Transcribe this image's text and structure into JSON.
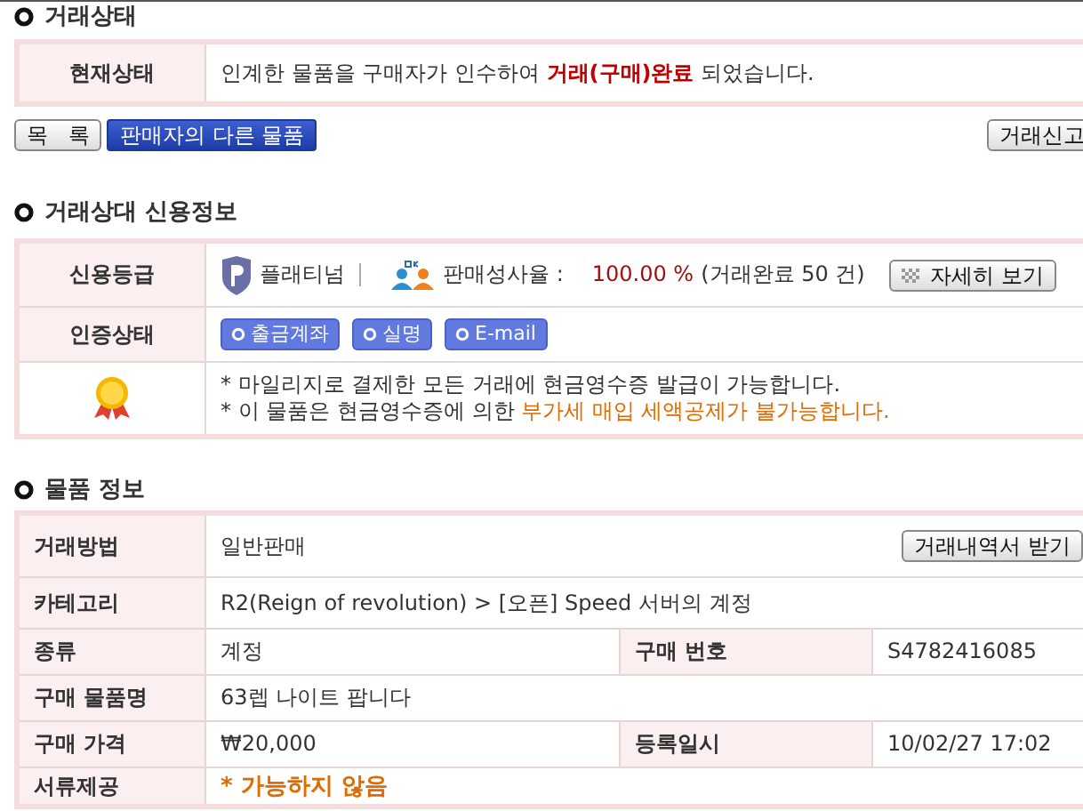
{
  "trade_status": {
    "heading": "거래상태",
    "label": "현재상태",
    "message": "인계한 물품을 구매자가 인수하여 **거래(구매)완료** 되었습니다."
  },
  "buttons": [
    {
      "label": "목   록",
      "kind": "plain"
    },
    {
      "label": "판매자의 다른 물품",
      "kind": "primary"
    }
  ],
  "report_button": "거래신고",
  "credit": {
    "heading": "거래상대 신용정보",
    "grade_label": "신용등급",
    "grade": "플래티넘",
    "rate_label": "판매성사율 :",
    "rate": "100.00 %",
    "completed": "(거래완료 50 건)",
    "detail_button": "자세히 보기",
    "cert_label": "인증상태",
    "certs": [
      "출금계좌",
      "실명",
      "E-mail"
    ],
    "notes": [
      {
        "text": "* 마일리지로 결제한 모든 거래에 현금영수증 발급이 가능합니다."
      },
      {
        "text": "* 이 물품은 현금영수증에 의한 ",
        "warning": "부가세 매입 세액공제가 불가능합니다."
      }
    ]
  },
  "product": {
    "heading": "물품 정보",
    "rows": [
      {
        "kind": "plain",
        "label": "거래방법",
        "value": "일반판매",
        "button": "거래내역서 받기"
      },
      {
        "kind": "plain",
        "label": "카테고리",
        "value": "R2(Reign of revolution) > [오픈] Speed 서버의 계정"
      },
      {
        "kind": "plain",
        "label": "종류",
        "value": "계정",
        "label2": "구매 번호",
        "value2": "S4782416085"
      },
      {
        "kind": "plain",
        "label": "구매 물품명",
        "value": "63렙 나이트 팝니다"
      },
      {
        "kind": "plain",
        "label": "구매 가격",
        "value": "₩20,000",
        "label2": "등록일시",
        "value2": "10/02/27 17:02"
      },
      {
        "kind": "warning",
        "label": "서류제공",
        "value": "* 가능하지 않음"
      }
    ]
  }
}
